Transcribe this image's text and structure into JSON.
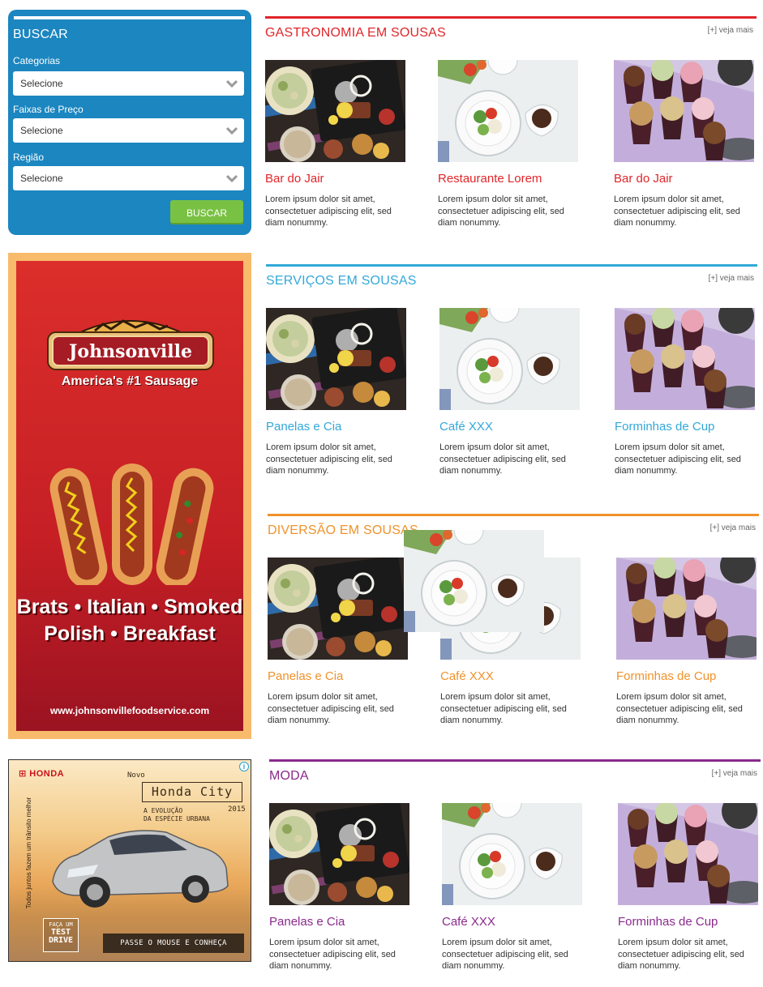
{
  "search": {
    "title": "BUSCAR",
    "fields": [
      {
        "label": "Categorias",
        "value": "Selecione"
      },
      {
        "label": "Faixas de Preço",
        "value": "Selecione"
      },
      {
        "label": "Região",
        "value": "Selecione"
      }
    ],
    "button": "BUSCAR"
  },
  "ad_johnsonville": {
    "brand": "Johnsonville",
    "tagline": "America's #1 Sausage",
    "products_line1": "Brats • Italian • Smoked",
    "products_line2": "Polish • Breakfast",
    "site": "www.johnsonvillefoodservice.com"
  },
  "ad_honda": {
    "brand": "HONDA",
    "novo": "Novo",
    "model": "Honda City",
    "year": "2015",
    "evo_line1": "A EVOLUÇÃO",
    "evo_line2": "DA ESPÉCIE URBANA",
    "side_text": "Todos juntos fazem um trânsito melhor",
    "test_line1": "FAÇA UM",
    "test_line2": "TEST",
    "test_line3": "DRIVE",
    "cta": "PASSE O MOUSE E CONHEÇA",
    "info": "i"
  },
  "sections": [
    {
      "title": "GASTRONOMIA EM SOUSAS",
      "more": "[+] veja mais",
      "color": "#e0262a",
      "items": [
        {
          "name": "Bar do Jair",
          "desc": "Lorem ipsum dolor sit amet, consectetuer adipiscing elit, sed diam nonummy.",
          "image": "grill-platter"
        },
        {
          "name": "Restaurante Lorem",
          "desc": "Lorem ipsum dolor sit amet, consectetuer adipiscing elit, sed diam nonummy.",
          "image": "salad-plate"
        },
        {
          "name": "Bar do Jair",
          "desc": "Lorem ipsum dolor sit amet, consectetuer adipiscing elit, sed diam nonummy.",
          "image": "cupcakes"
        }
      ]
    },
    {
      "title": "SERVIÇOS EM SOUSAS",
      "more": "[+] veja mais",
      "color": "#33a8d9",
      "items": [
        {
          "name": "Panelas e Cia",
          "desc": "Lorem ipsum dolor sit amet, consectetuer adipiscing elit, sed diam nonummy.",
          "image": "grill-platter"
        },
        {
          "name": "Café XXX",
          "desc": "Lorem ipsum dolor sit amet, consectetuer adipiscing elit, sed diam nonummy.",
          "image": "salad-plate"
        },
        {
          "name": "Forminhas de Cup",
          "desc": "Lorem ipsum dolor sit amet, consectetuer adipiscing elit, sed diam nonummy.",
          "image": "cupcakes"
        }
      ]
    },
    {
      "title": "DIVERSÃO EM SOUSAS",
      "more": "[+] veja mais",
      "color": "#f0922b",
      "items": [
        {
          "name": "Panelas e Cia",
          "desc": "Lorem ipsum dolor sit amet, consectetuer adipiscing elit, sed diam nonummy.",
          "image": "grill-platter"
        },
        {
          "name": "Café XXX",
          "desc": "Lorem ipsum dolor sit amet, consectetuer adipiscing elit, sed diam nonummy.",
          "image": "salad-plate"
        },
        {
          "name": "Forminhas de Cup",
          "desc": "Lorem ipsum dolor sit amet, consectetuer adipiscing elit, sed diam nonummy.",
          "image": "cupcakes"
        }
      ]
    },
    {
      "title": "MODA",
      "more": "[+] veja mais",
      "color": "#8a2a8c",
      "items": [
        {
          "name": "Panelas e Cia",
          "desc": "Lorem ipsum dolor sit amet, consectetuer adipiscing elit, sed diam nonummy.",
          "image": "grill-platter"
        },
        {
          "name": "Café XXX",
          "desc": "Lorem ipsum dolor sit amet, consectetuer adipiscing elit, sed diam nonummy.",
          "image": "salad-plate"
        },
        {
          "name": "Forminhas de Cup",
          "desc": "Lorem ipsum dolor sit amet, consectetuer adipiscing elit, sed diam nonummy.",
          "image": "cupcakes"
        }
      ]
    }
  ]
}
